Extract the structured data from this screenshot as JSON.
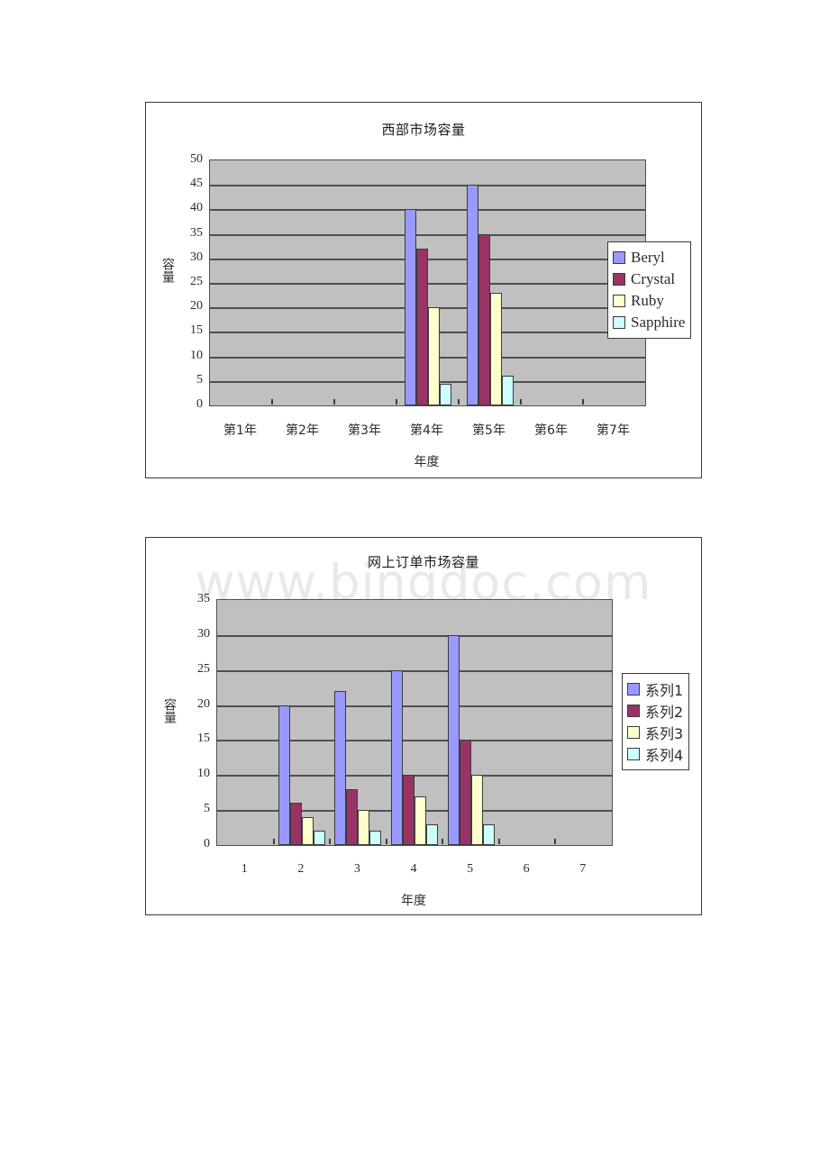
{
  "page": {
    "background": "#ffffff",
    "watermark": "www.bingdoc.com"
  },
  "palette": {
    "series1": "#9999ff",
    "series2": "#993366",
    "series3": "#ffffcc",
    "series4": "#ccffff",
    "plot_background": "#c0c0c0",
    "gridline": "#4f4f4f",
    "bar_border": "#3b3b3b",
    "frame_border": "#3a3a3a",
    "text": "#2b2b2b"
  },
  "chart_data": [
    {
      "id": "chart-west-market-capacity",
      "type": "bar",
      "title": "西部市场容量",
      "xlabel": "年度",
      "ylabel": "容量",
      "ylim": [
        0,
        50
      ],
      "ytick_step": 5,
      "yticks": [
        "0",
        "5",
        "10",
        "15",
        "20",
        "25",
        "30",
        "35",
        "40",
        "45",
        "50"
      ],
      "categories": [
        "第1年",
        "第2年",
        "第3年",
        "第4年",
        "第5年",
        "第6年",
        "第7年"
      ],
      "grid": true,
      "legend_position": "right",
      "series": [
        {
          "name": "Beryl",
          "color": "#9999ff",
          "values": [
            0,
            0,
            0,
            40,
            45,
            0,
            0
          ]
        },
        {
          "name": "Crystal",
          "color": "#993366",
          "values": [
            0,
            0,
            0,
            32,
            35,
            0,
            0
          ]
        },
        {
          "name": "Ruby",
          "color": "#ffffcc",
          "values": [
            0,
            0,
            0,
            20,
            23,
            0,
            0
          ]
        },
        {
          "name": "Sapphire",
          "color": "#ccffff",
          "values": [
            0,
            0,
            0,
            4.5,
            6,
            0,
            0
          ]
        }
      ]
    },
    {
      "id": "chart-online-order-market-capacity",
      "type": "bar",
      "title": "网上订单市场容量",
      "xlabel": "年度",
      "ylabel": "容量",
      "ylim": [
        0,
        35
      ],
      "ytick_step": 5,
      "yticks": [
        "0",
        "5",
        "10",
        "15",
        "20",
        "25",
        "30",
        "35"
      ],
      "categories": [
        "1",
        "2",
        "3",
        "4",
        "5",
        "6",
        "7"
      ],
      "grid": true,
      "legend_position": "right",
      "series": [
        {
          "name": "系列1",
          "color": "#9999ff",
          "values": [
            0,
            20,
            22,
            25,
            30,
            0,
            0
          ]
        },
        {
          "name": "系列2",
          "color": "#993366",
          "values": [
            0,
            6,
            8,
            10,
            15,
            0,
            0
          ]
        },
        {
          "name": "系列3",
          "color": "#ffffcc",
          "values": [
            0,
            4,
            5,
            7,
            10,
            0,
            0
          ]
        },
        {
          "name": "系列4",
          "color": "#ccffff",
          "values": [
            0,
            2,
            2,
            3,
            3,
            0,
            0
          ]
        }
      ]
    }
  ]
}
